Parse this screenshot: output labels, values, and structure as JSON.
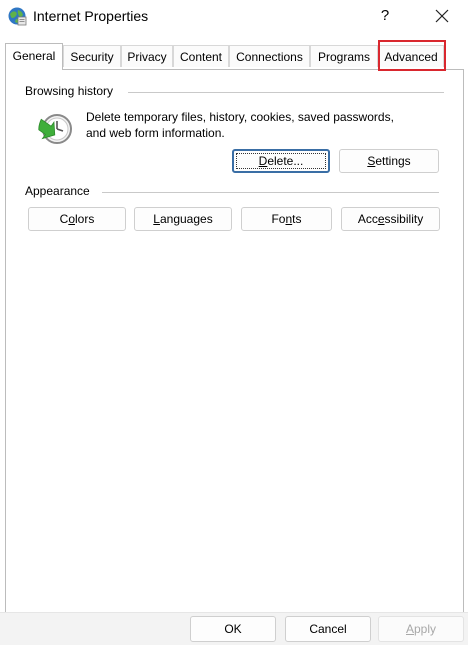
{
  "window": {
    "title": "Internet Properties",
    "help_label": "?"
  },
  "tabs": [
    {
      "label": "General",
      "active": true
    },
    {
      "label": "Security"
    },
    {
      "label": "Privacy"
    },
    {
      "label": "Content"
    },
    {
      "label": "Connections"
    },
    {
      "label": "Programs"
    },
    {
      "label": "Advanced",
      "highlighted": true
    }
  ],
  "browsing_history": {
    "heading": "Browsing history",
    "description_line1": "Delete temporary files, history, cookies, saved passwords,",
    "description_line2": "and web form information.",
    "delete_pre": "",
    "delete_key": "D",
    "delete_post": "elete...",
    "settings_pre": "",
    "settings_key": "S",
    "settings_post": "ettings",
    "icon": "clock-with-green-arrow-icon"
  },
  "appearance": {
    "heading": "Appearance",
    "colors_pre": "C",
    "colors_key": "o",
    "colors_post": "lors",
    "languages_pre": "",
    "languages_key": "L",
    "languages_post": "anguages",
    "fonts_pre": "Fo",
    "fonts_key": "n",
    "fonts_post": "ts",
    "accessibility_pre": "Acc",
    "accessibility_key": "e",
    "accessibility_post": "ssibility"
  },
  "footer": {
    "ok_label": "OK",
    "cancel_label": "Cancel",
    "apply_pre": "",
    "apply_key": "A",
    "apply_post": "pply"
  },
  "colors": {
    "highlight": "#d9272e",
    "default_button_border": "#3a6ea5",
    "footer_bg": "#f3f3f3"
  }
}
